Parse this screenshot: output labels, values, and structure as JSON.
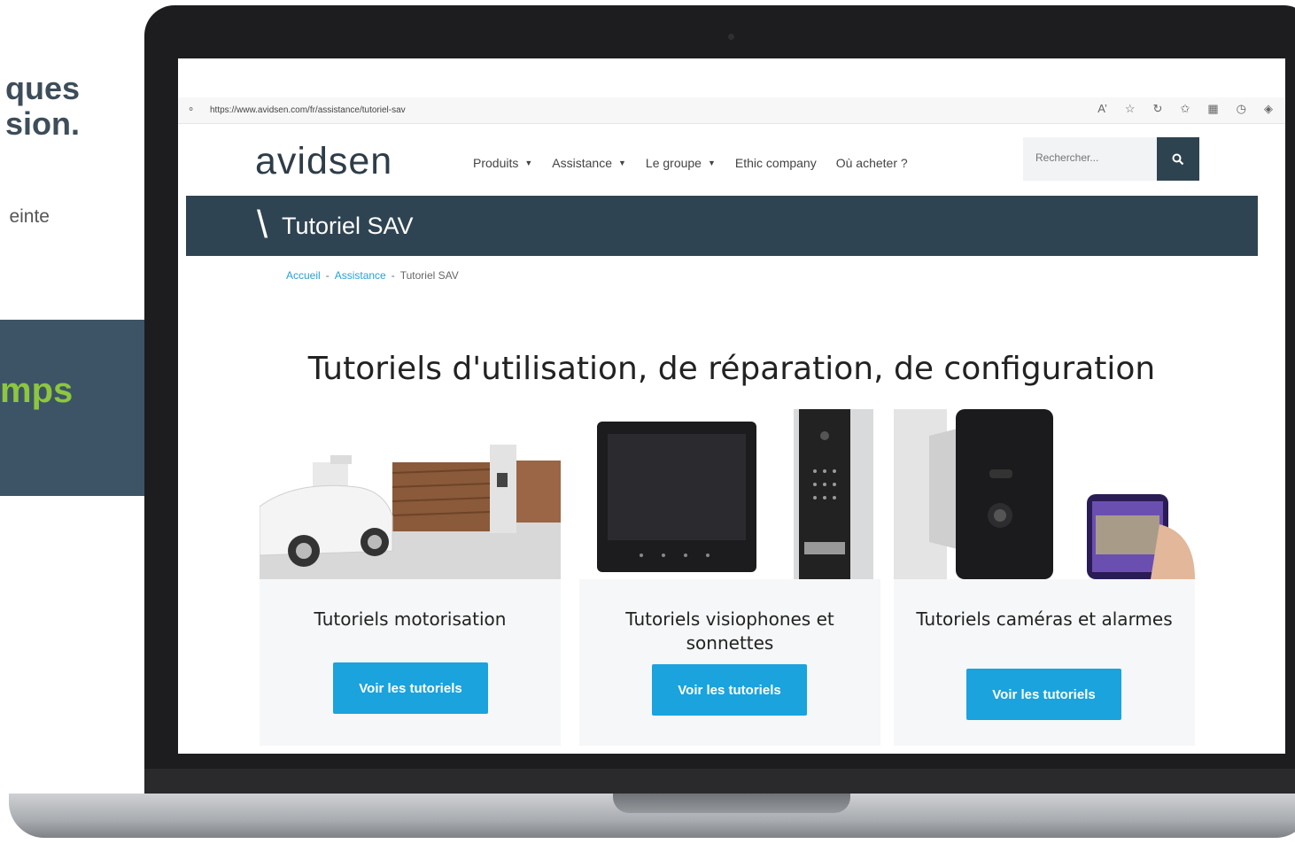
{
  "left": {
    "heading_line1": "ques",
    "heading_line2": "sion.",
    "subtext": "einte",
    "panel_text": "mps"
  },
  "browser": {
    "url": "https://www.avidsen.com/fr/assistance/tutoriel-sav"
  },
  "site": {
    "logo": "avidsen",
    "nav": [
      {
        "label": "Produits",
        "has_dropdown": true
      },
      {
        "label": "Assistance",
        "has_dropdown": true
      },
      {
        "label": "Le groupe",
        "has_dropdown": true
      },
      {
        "label": "Ethic company",
        "has_dropdown": false
      },
      {
        "label": "Où acheter ?",
        "has_dropdown": false
      }
    ],
    "search_placeholder": "Rechercher..."
  },
  "title_band": {
    "slash": "\\",
    "title": "Tutoriel SAV"
  },
  "breadcrumb": {
    "home": "Accueil",
    "sep": "-",
    "assistance": "Assistance",
    "current": "Tutoriel SAV"
  },
  "page": {
    "heading": "Tutoriels d'utilisation, de réparation, de configuration"
  },
  "cards": [
    {
      "title": "Tutoriels motorisation",
      "button": "Voir les tutoriels"
    },
    {
      "title": "Tutoriels visiophones et sonnettes",
      "button": "Voir les tutoriels"
    },
    {
      "title": "Tutoriels caméras et alarmes",
      "button": "Voir les tutoriels"
    }
  ],
  "colors": {
    "header_band": "#2f4452",
    "button": "#1aa3dd",
    "panel": "#3d5466",
    "panel_accent": "#8dc63f"
  }
}
